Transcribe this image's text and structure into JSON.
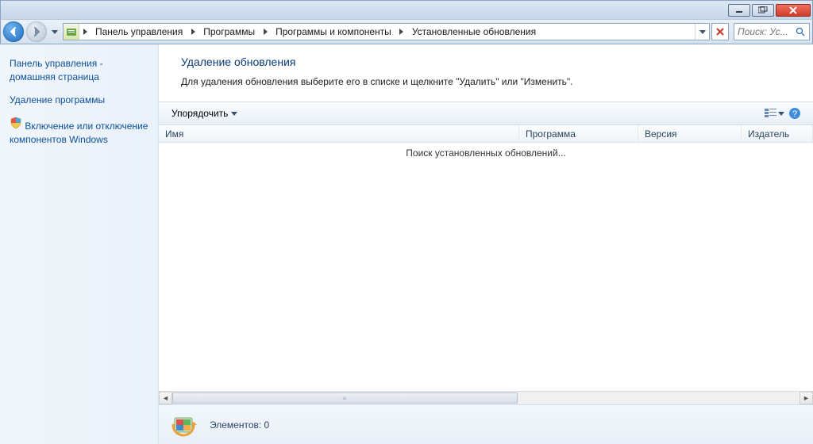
{
  "breadcrumb": {
    "items": [
      "Панель управления",
      "Программы",
      "Программы и компоненты",
      "Установленные обновления"
    ]
  },
  "search": {
    "placeholder": "Поиск: Ус..."
  },
  "sidebar": {
    "home1": "Панель управления -",
    "home2": "домашняя страница",
    "uninstall": "Удаление программы",
    "features1": "Включение или отключение",
    "features2": "компонентов Windows"
  },
  "page": {
    "title": "Удаление обновления",
    "desc": "Для удаления обновления выберите его в списке и щелкните \"Удалить\" или \"Изменить\"."
  },
  "toolbar": {
    "organize": "Упорядочить"
  },
  "columns": {
    "name": "Имя",
    "program": "Программа",
    "version": "Версия",
    "publisher": "Издатель"
  },
  "list": {
    "searching": "Поиск установленных обновлений..."
  },
  "status": {
    "count_label": "Элементов: 0"
  }
}
